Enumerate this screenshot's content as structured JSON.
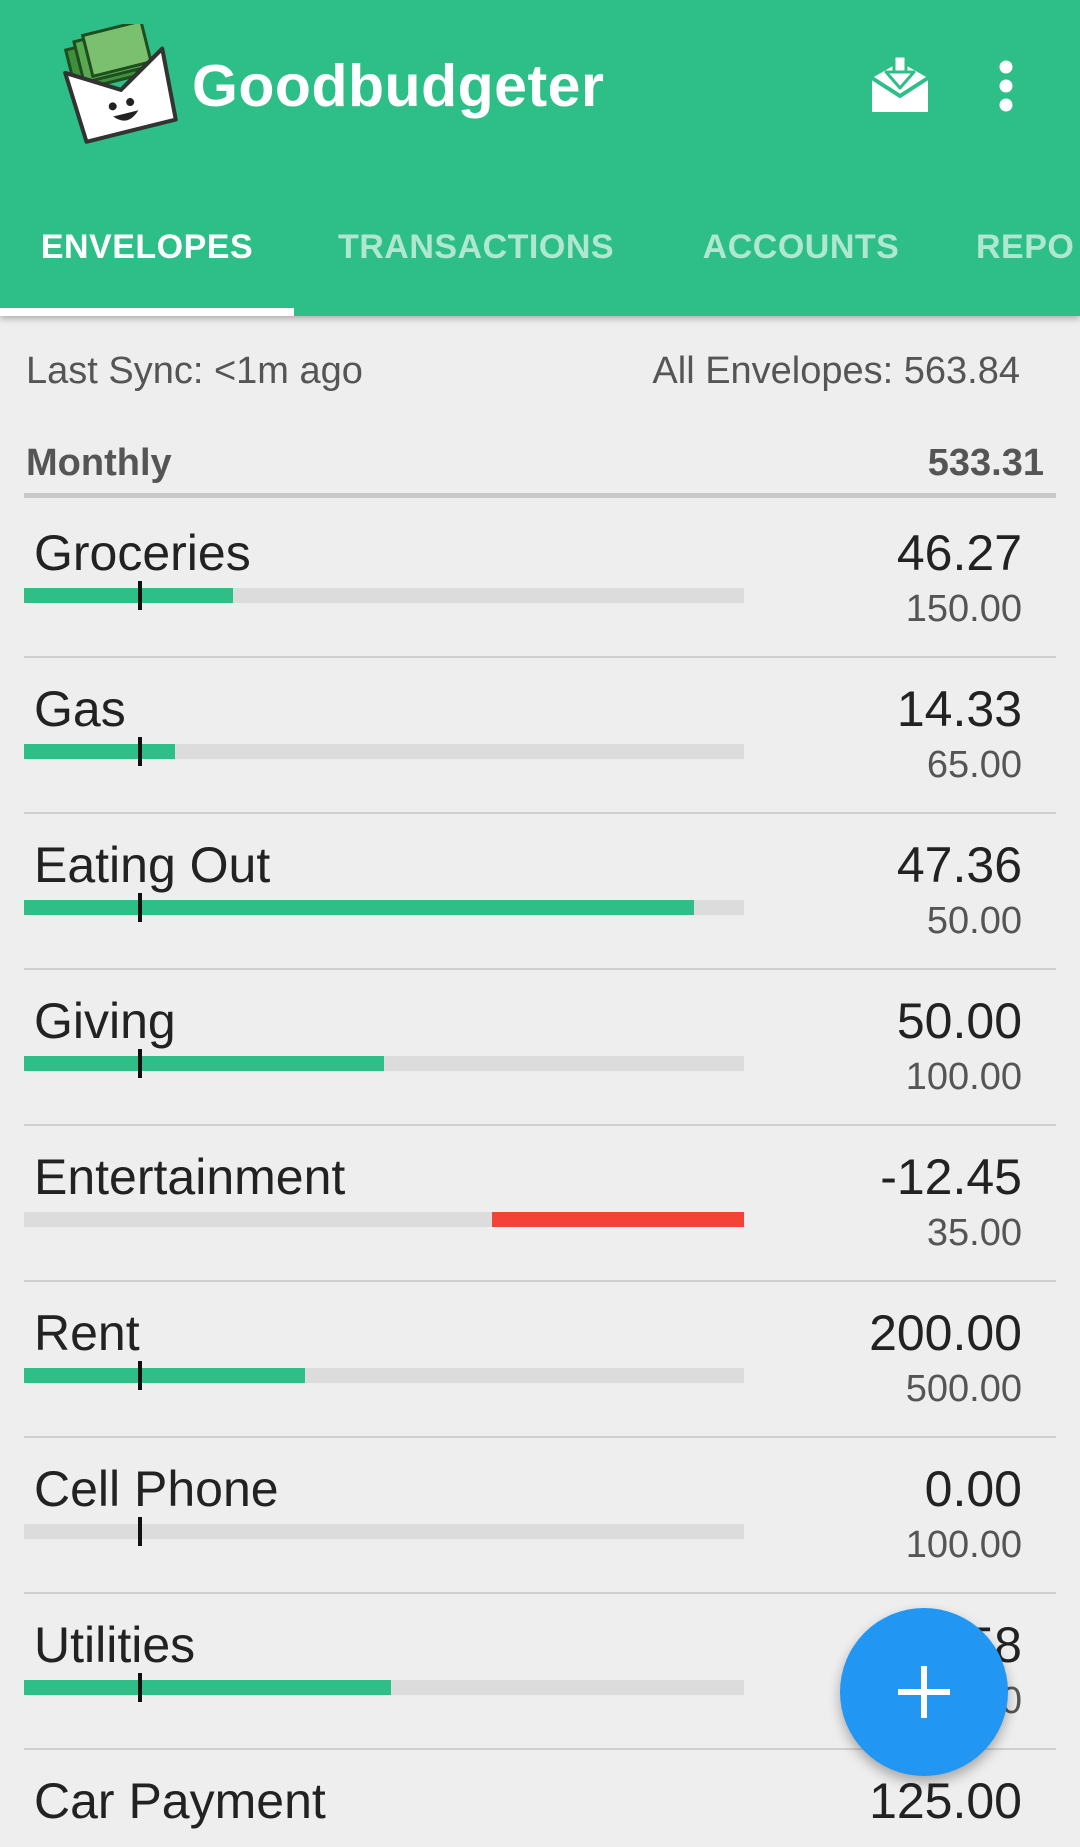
{
  "app": {
    "title": "Goodbudgeter",
    "sync_icon": "cloud-download-icon",
    "more_icon": "more-vert-icon",
    "accent_color": "#2dbf87",
    "fab_color": "#2196f3",
    "overspent_color": "#f44336"
  },
  "tabs": [
    {
      "label": "ENVELOPES",
      "active": true
    },
    {
      "label": "TRANSACTIONS",
      "active": false
    },
    {
      "label": "ACCOUNTS",
      "active": false
    },
    {
      "label": "REPO",
      "active": false
    }
  ],
  "summary": {
    "last_sync": "Last Sync: <1m ago",
    "all_envelopes": "All Envelopes: 563.84"
  },
  "group": {
    "name": "Monthly",
    "total": "533.31"
  },
  "envelopes": [
    {
      "name": "Groceries",
      "amount": "46.27",
      "budget": "150.00",
      "progress": 0.29,
      "overspent": false
    },
    {
      "name": "Gas",
      "amount": "14.33",
      "budget": "65.00",
      "progress": 0.21,
      "overspent": false
    },
    {
      "name": "Eating Out",
      "amount": "47.36",
      "budget": "50.00",
      "progress": 0.93,
      "overspent": false
    },
    {
      "name": "Giving",
      "amount": "50.00",
      "budget": "100.00",
      "progress": 0.5,
      "overspent": false
    },
    {
      "name": "Entertainment",
      "amount": "-12.45",
      "budget": "35.00",
      "progress": 0.35,
      "overspent": true
    },
    {
      "name": "Rent",
      "amount": "200.00",
      "budget": "500.00",
      "progress": 0.39,
      "overspent": false
    },
    {
      "name": "Cell Phone",
      "amount": "0.00",
      "budget": "100.00",
      "progress": 0.0,
      "overspent": false
    },
    {
      "name": "Utilities",
      "amount": "58",
      "budget": "0",
      "progress": 0.51,
      "overspent": false
    },
    {
      "name": "Car Payment",
      "amount": "125.00",
      "budget": "",
      "progress": 0.0,
      "overspent": false
    }
  ],
  "fab": {
    "icon": "plus-icon"
  }
}
